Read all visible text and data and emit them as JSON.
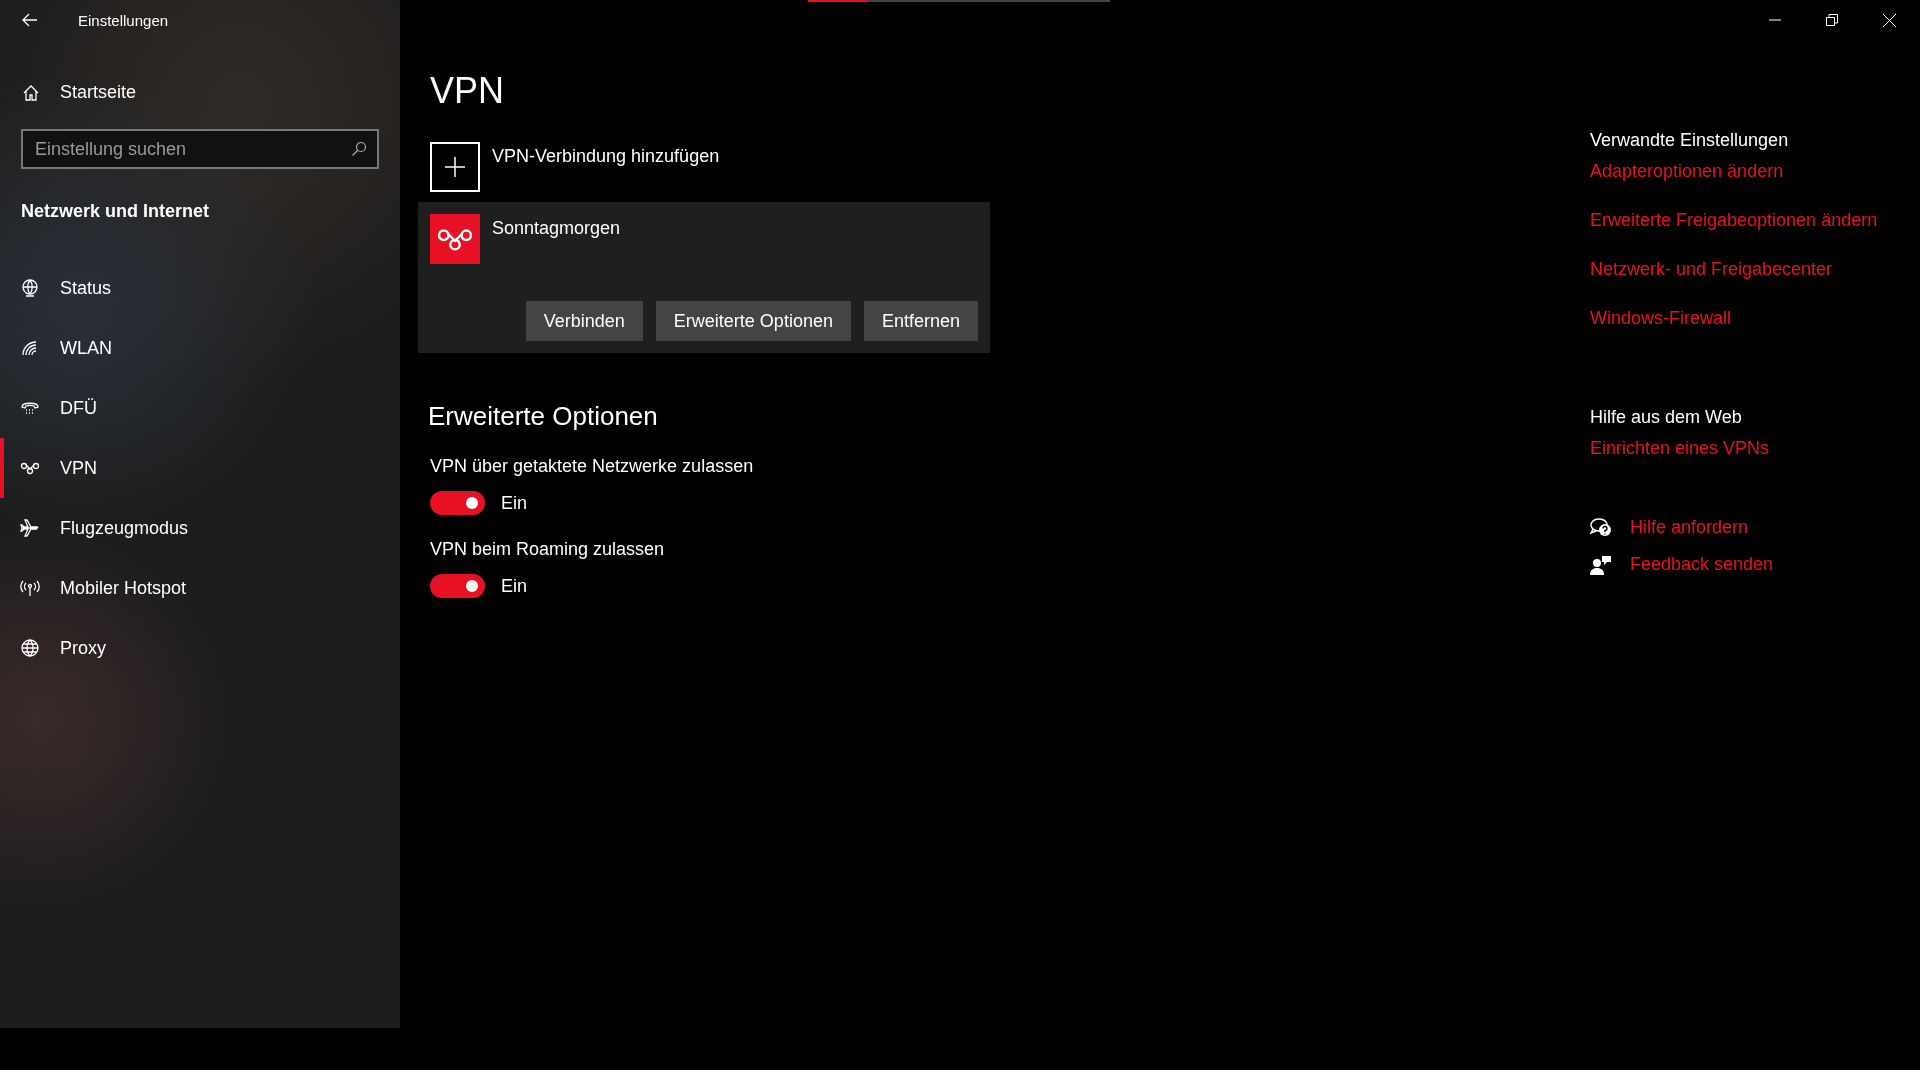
{
  "window": {
    "title": "Einstellungen"
  },
  "sidebar": {
    "home": "Startseite",
    "search": {
      "placeholder": "Einstellung suchen"
    },
    "section": "Netzwerk und Internet",
    "items": [
      {
        "kind": "status",
        "label": "Status",
        "selected": false
      },
      {
        "kind": "wlan",
        "label": "WLAN",
        "selected": false
      },
      {
        "kind": "dialup",
        "label": "DFÜ",
        "selected": false
      },
      {
        "kind": "vpn",
        "label": "VPN",
        "selected": true
      },
      {
        "kind": "airplane",
        "label": "Flugzeugmodus",
        "selected": false
      },
      {
        "kind": "hotspot",
        "label": "Mobiler Hotspot",
        "selected": false
      },
      {
        "kind": "proxy",
        "label": "Proxy",
        "selected": false
      }
    ]
  },
  "page": {
    "title": "VPN",
    "add_label": "VPN-Verbindung hinzufügen",
    "connection": {
      "name": "Sonntagmorgen",
      "buttons": [
        "Verbinden",
        "Erweiterte Optionen",
        "Entfernen"
      ]
    },
    "advanced": {
      "heading": "Erweiterte Optionen",
      "toggles": [
        {
          "label": "VPN über getaktete Netzwerke zulassen",
          "on": true,
          "state": "Ein"
        },
        {
          "label": "VPN beim Roaming zulassen",
          "on": true,
          "state": "Ein"
        }
      ]
    }
  },
  "related": {
    "heading": "Verwandte Einstellungen",
    "links": [
      "Adapteroptionen ändern",
      "Erweiterte Freigabeoptionen ändern",
      "Netzwerk- und Freigabecenter",
      "Windows-Firewall"
    ]
  },
  "web_help": {
    "heading": "Hilfe aus dem Web",
    "links": [
      "Einrichten eines VPNs"
    ]
  },
  "support": [
    {
      "kind": "help",
      "label": "Hilfe anfordern"
    },
    {
      "kind": "feedback",
      "label": "Feedback senden"
    }
  ]
}
